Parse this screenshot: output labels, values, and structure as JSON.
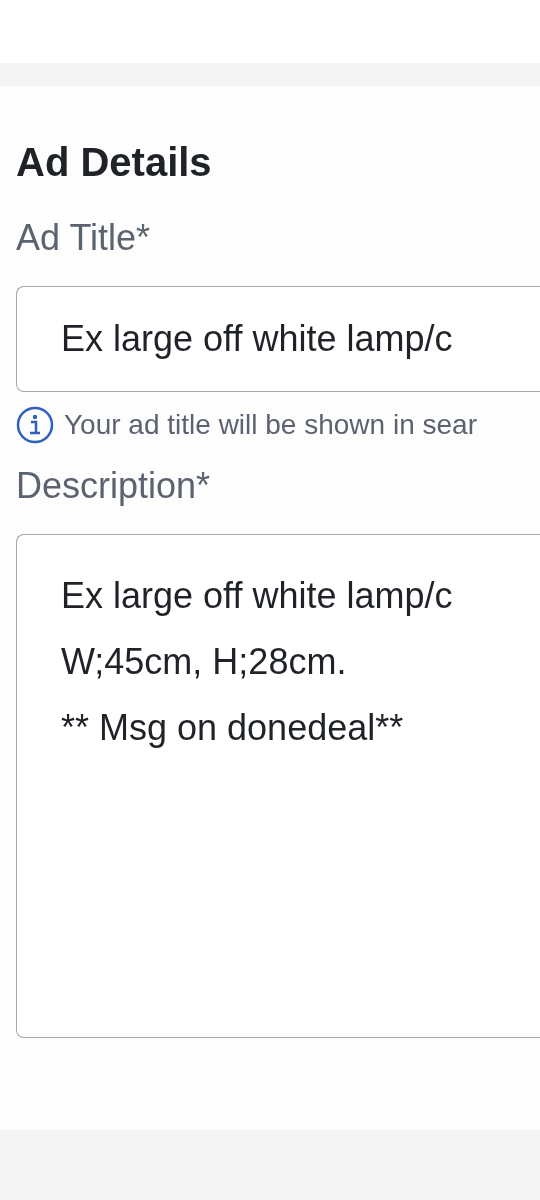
{
  "section_title": "Ad Details",
  "fields": [
    {
      "kind": "input",
      "label": "Ad Title*",
      "value": "Ex large off white lamp/c",
      "hint": "Your ad title will be shown in sear"
    },
    {
      "kind": "textarea",
      "label": "Description*",
      "value": "Ex large off white lamp/c\nW;45cm, H;28cm.\n** Msg on donedeal**"
    }
  ]
}
